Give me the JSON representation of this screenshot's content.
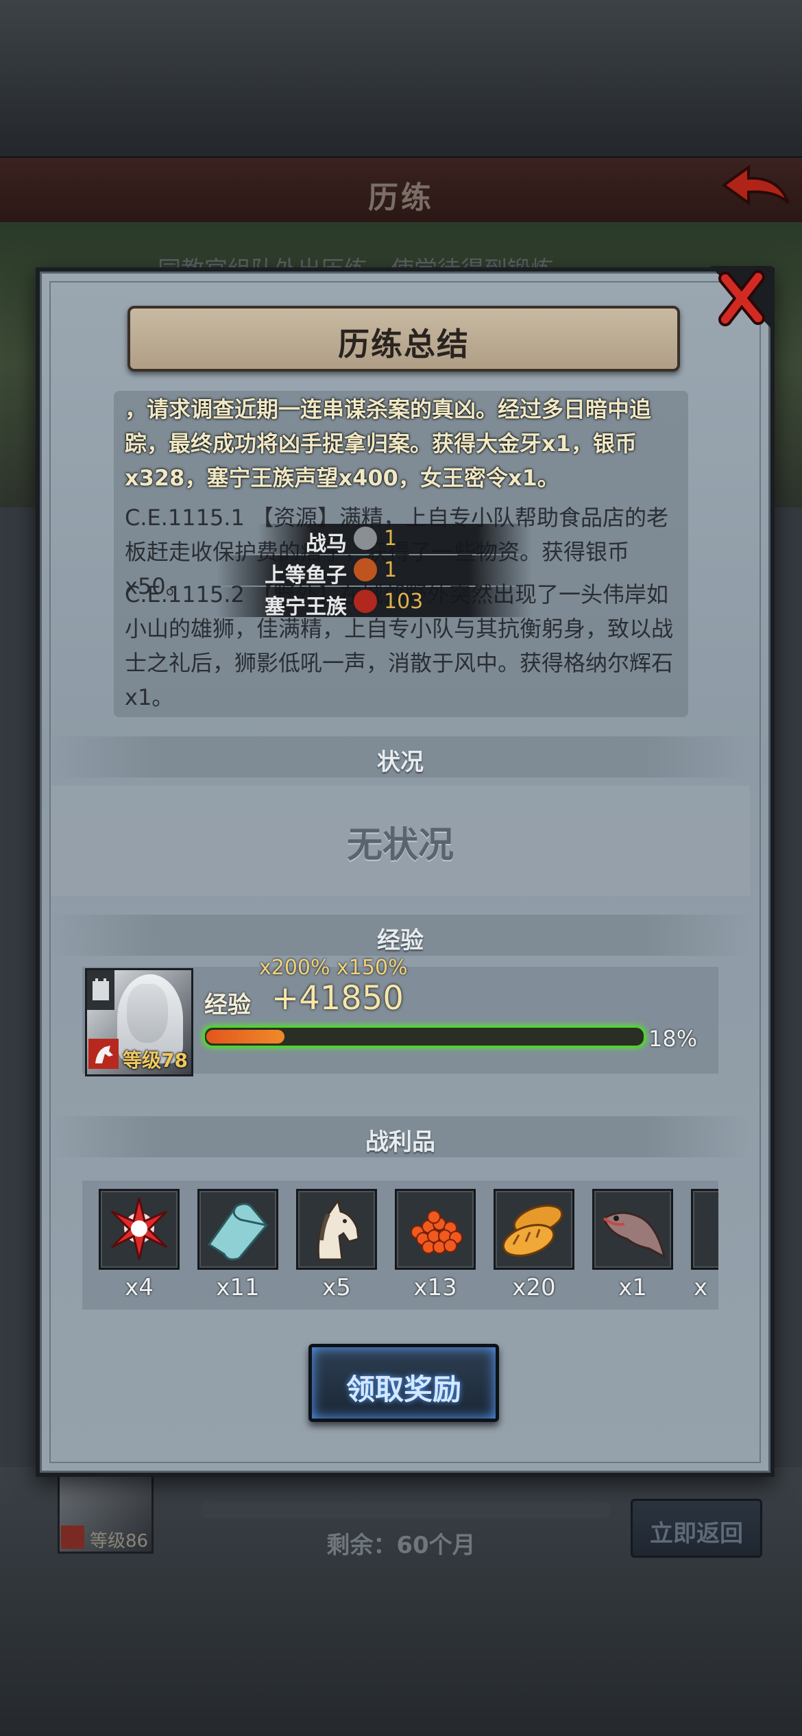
{
  "header": {
    "title": "历练"
  },
  "background": {
    "subtitle": "同教官组队外出历练，使学徒得到锻炼",
    "remaining": "剩余：60个月",
    "return_label": "立即返回",
    "hero_level": "等级86"
  },
  "dialog": {
    "title": "历练总结",
    "log": [
      "，请求调查近期一连串谋杀案的真凶。经过多日暗中追踪，最终成功将凶手捉拿归案。获得大金牙x1，银币x328，塞宁王族声望x400，女王密令x1。",
      "C.E.1115.1 【资源】满精，上自专小队帮助食品店的老板赶走收保护费的痞子，获得了一些物资。获得银币x50。",
      "C.E.1115.2 【野外】在城郊野外突然出现了一头伟岸如小山的雄狮，佳满精，上自专小队与其抗衡躬身，致以战士之礼后，狮影低吼一声，消散于风中。获得格纳尔辉石x1。"
    ],
    "tooltip": [
      {
        "label": "战马",
        "value": "1",
        "icon_color": "#8a8f94"
      },
      {
        "label": "上等鱼子",
        "value": "1",
        "icon_color": "#c0541e"
      },
      {
        "label": "塞宁王族",
        "value": "103",
        "icon_color": "#b0281e"
      }
    ],
    "status": {
      "heading": "状况",
      "value": "无状况"
    },
    "exp": {
      "heading": "经验",
      "multipliers": "x200%  x150%",
      "label": "经验",
      "gain": "+41850",
      "level": "等级78",
      "progress": 0.18,
      "percent_text": "18%"
    },
    "loot": {
      "heading": "战利品",
      "items": [
        {
          "name": "star-shard",
          "count": "x4"
        },
        {
          "name": "cloth-roll",
          "count": "x11"
        },
        {
          "name": "horse",
          "count": "x5"
        },
        {
          "name": "caviar",
          "count": "x13"
        },
        {
          "name": "bread",
          "count": "x20"
        },
        {
          "name": "fish",
          "count": "x1"
        },
        {
          "name": "more",
          "count": "x"
        }
      ]
    },
    "claim_label": "领取奖励"
  },
  "colors": {
    "accent_gold": "#e0b24a",
    "exp_bar": "#4fd42c",
    "close_red": "#d22a22"
  }
}
